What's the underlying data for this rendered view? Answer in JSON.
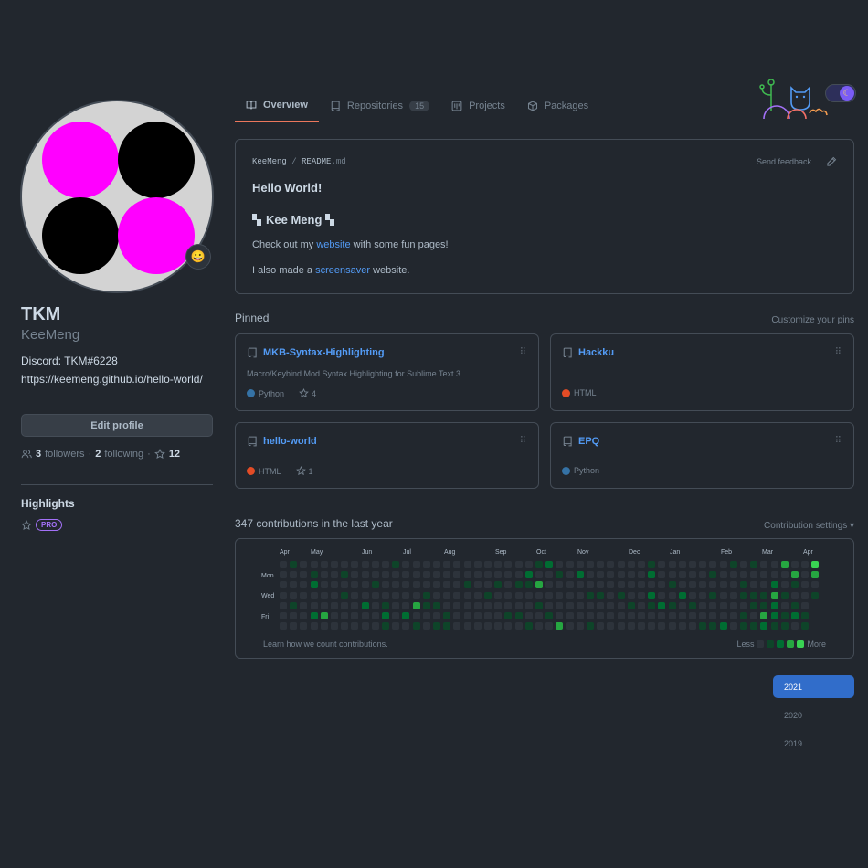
{
  "tabs": [
    {
      "label": "Overview",
      "icon": "book-icon",
      "active": true
    },
    {
      "label": "Repositories",
      "icon": "repo-icon",
      "count": "15"
    },
    {
      "label": "Projects",
      "icon": "project-icon"
    },
    {
      "label": "Packages",
      "icon": "package-icon"
    }
  ],
  "profile": {
    "name": "TKM",
    "login": "KeeMeng",
    "bio": "Discord: TKM#6228",
    "website": "https://keemeng.github.io/hello-world/",
    "status_emoji": "😀",
    "edit_label": "Edit profile",
    "followers_count": "3",
    "followers_label": "followers",
    "following_count": "2",
    "following_label": "following",
    "stars_count": "12"
  },
  "highlights": {
    "title": "Highlights",
    "badge": "PRO"
  },
  "readme": {
    "owner": "KeeMeng",
    "sep": "/",
    "file": "README",
    "ext": ".md",
    "feedback": "Send feedback",
    "heading": "Hello World!",
    "subheading": "Kee Meng",
    "line1_pre": "Check out my ",
    "line1_link": "website",
    "line1_post": " with some fun pages!",
    "line2_pre": "I also made a ",
    "line2_link": "screensaver",
    "line2_post": " website."
  },
  "pinned": {
    "title": "Pinned",
    "customize": "Customize your pins",
    "items": [
      {
        "name": "MKB-Syntax-Highlighting",
        "description": "Macro/Keybind Mod Syntax Highlighting for Sublime Text 3",
        "language": "Python",
        "lang_color": "#3572a5",
        "stars": "4"
      },
      {
        "name": "Hackku",
        "description": "",
        "language": "HTML",
        "lang_color": "#e34c26",
        "stars": ""
      },
      {
        "name": "hello-world",
        "description": "",
        "language": "HTML",
        "lang_color": "#e34c26",
        "stars": "1"
      },
      {
        "name": "EPQ",
        "description": "",
        "language": "Python",
        "lang_color": "#3572a5",
        "stars": ""
      }
    ]
  },
  "contributions": {
    "title": "347 contributions in the last year",
    "settings": "Contribution settings ▾",
    "months": [
      "Apr",
      "May",
      "Jun",
      "Jul",
      "Aug",
      "Sep",
      "Oct",
      "Nov",
      "Dec",
      "Jan",
      "Feb",
      "Mar",
      "Apr"
    ],
    "weekdays": [
      "Mon",
      "Wed",
      "Fri"
    ],
    "learn": "Learn how we count contributions.",
    "less": "Less",
    "more": "More",
    "colors": [
      "#2d333b",
      "#0e4429",
      "#006d32",
      "#26a641",
      "#39d353"
    ]
  },
  "years": [
    "2021",
    "2020",
    "2019"
  ]
}
